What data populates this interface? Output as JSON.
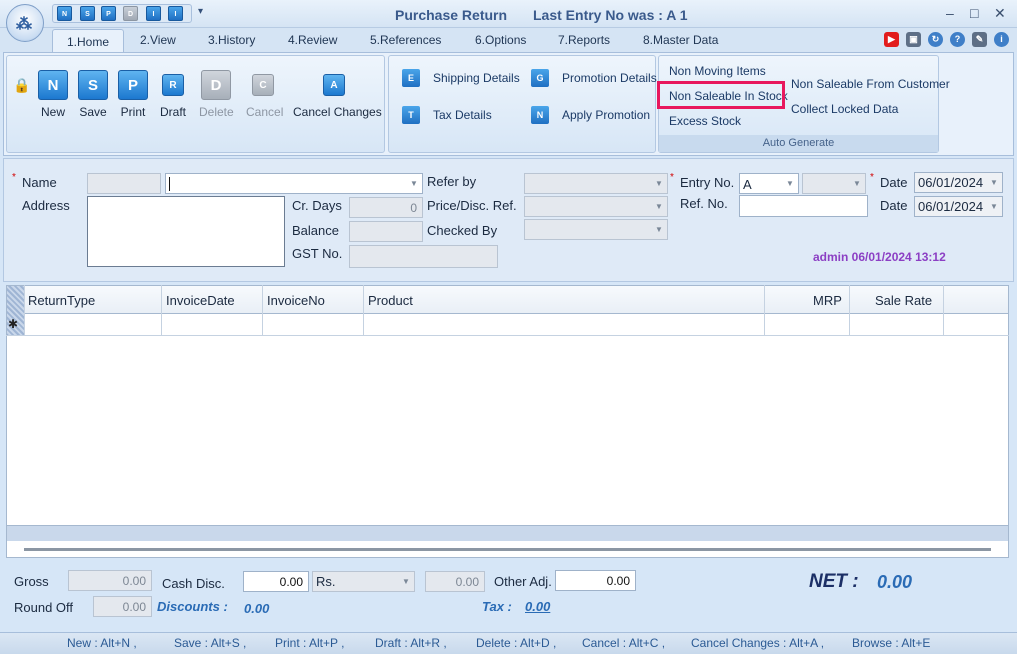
{
  "window": {
    "title": "Purchase Return",
    "last_entry": "Last Entry No was : A 1"
  },
  "quick_access": [
    "N",
    "S",
    "P",
    "D",
    "I",
    "I"
  ],
  "tabs": [
    "1.Home",
    "2.View",
    "3.History",
    "4.Review",
    "5.References",
    "6.Options",
    "7.Reports",
    "8.Master Data"
  ],
  "toolbar": {
    "new": "New",
    "save": "Save",
    "print": "Print",
    "draft": "Draft",
    "delete": "Delete",
    "cancel": "Cancel",
    "cancel_changes": "Cancel Changes",
    "new_glyph": "N",
    "save_glyph": "S",
    "print_glyph": "P",
    "draft_glyph": "R",
    "delete_glyph": "D",
    "cancel_glyph": "C",
    "cc_glyph": "A"
  },
  "details": {
    "shipping": "Shipping Details",
    "tax": "Tax Details",
    "promotion": "Promotion Details",
    "apply_promotion": "Apply Promotion",
    "shipping_glyph": "E",
    "tax_glyph": "T",
    "promotion_glyph": "G",
    "apply_glyph": "N"
  },
  "auto_generate": {
    "label": "Auto Generate",
    "non_moving": "Non Moving Items",
    "non_saleable_stock": "Non Saleable In Stock",
    "excess_stock": "Excess Stock",
    "non_saleable_customer": "Non Saleable From Customer",
    "collect_locked": "Collect Locked Data"
  },
  "form": {
    "name_label": "Name",
    "address_label": "Address",
    "cr_days_label": "Cr. Days",
    "cr_days_value": "0",
    "balance_label": "Balance",
    "gst_label": "GST No.",
    "refer_by_label": "Refer by",
    "price_disc_label": "Price/Disc. Ref.",
    "checked_by_label": "Checked By",
    "entry_no_label": "Entry No.",
    "entry_no_value": "A",
    "ref_no_label": "Ref. No.",
    "date_label": "Date",
    "date_value": "06/01/2024",
    "date2_label": "Date",
    "date2_value": "06/01/2024",
    "stamp": "admin 06/01/2024 13:12"
  },
  "grid": {
    "columns": [
      "ReturnType",
      "InvoiceDate",
      "InvoiceNo",
      "Product",
      "MRP",
      "Sale Rate"
    ],
    "new_row_marker": "✱"
  },
  "totals": {
    "gross_label": "Gross",
    "gross_value": "0.00",
    "round_off_label": "Round Off",
    "round_off_value": "0.00",
    "cash_disc_label": "Cash Disc.",
    "cash_disc_value": "0.00",
    "cash_disc_unit": "Rs.",
    "cash_disc_amount": "0.00",
    "other_adj_label": "Other Adj.",
    "other_adj_value": "0.00",
    "discounts_label": "Discounts :",
    "discounts_value": "0.00",
    "tax_label": "Tax :",
    "tax_value": "0.00",
    "net_label": "NET :",
    "net_value": "0.00"
  },
  "shortcuts": [
    "New : Alt+N ,",
    "Save : Alt+S ,",
    "Print : Alt+P ,",
    "Draft : Alt+R ,",
    "Delete : Alt+D ,",
    "Cancel : Alt+C ,",
    "Cancel Changes : Alt+A ,",
    "Browse : Alt+E"
  ],
  "colors": {
    "accent": "#2a6bb5",
    "highlight": "#e8175d",
    "stamp": "#8c3fc4"
  }
}
